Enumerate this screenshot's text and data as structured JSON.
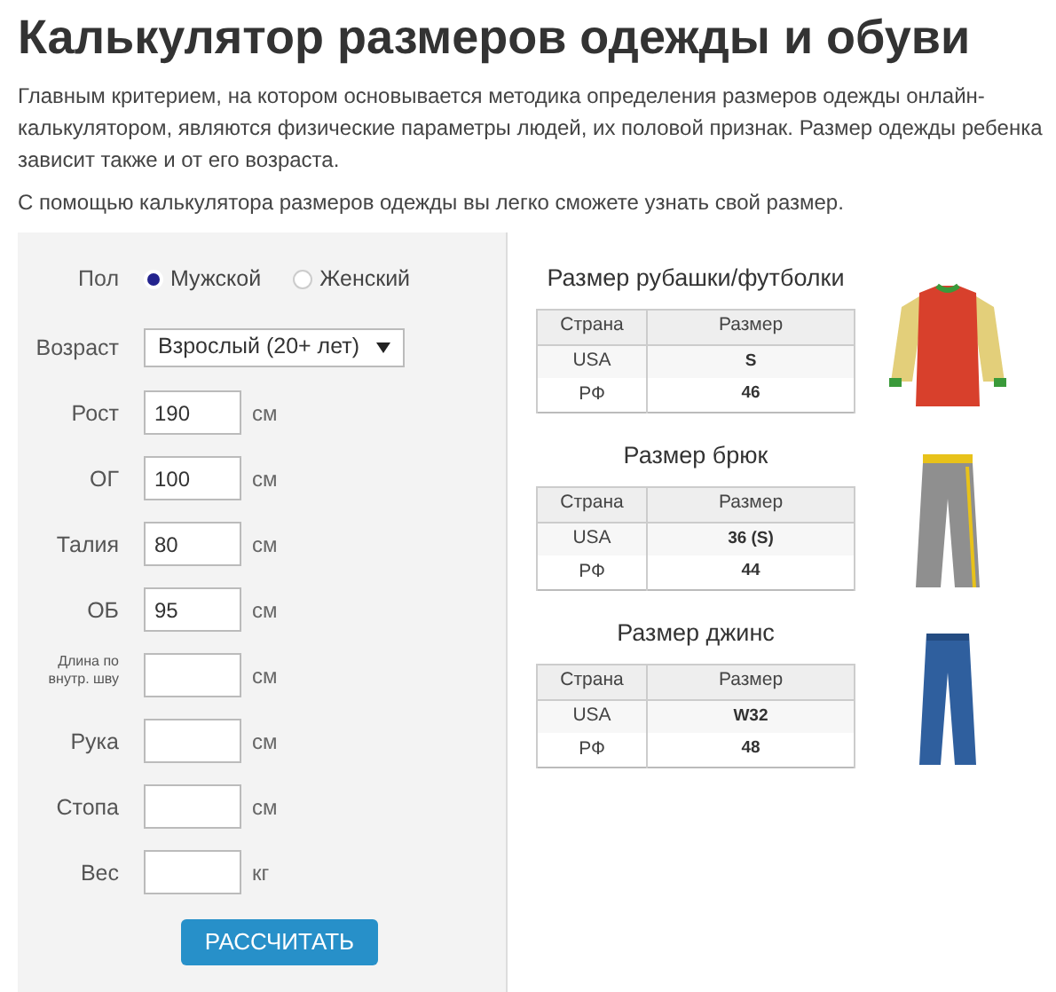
{
  "title": "Калькулятор размеров одежды и обуви",
  "intro": [
    "Главным критерием, на котором основывается методика определения размеров одежды онлайн-калькулятором, являются физические параметры людей, их половой признак. Размер одежды ребенка зависит также и от его возраста.",
    "С помощью калькулятора размеров одежды вы легко сможете узнать свой размер."
  ],
  "form": {
    "fields": [
      {
        "kind": "radio",
        "label": "Пол",
        "options": [
          {
            "label": "Мужской",
            "selected": true
          },
          {
            "label": "Женский",
            "selected": false
          }
        ]
      },
      {
        "kind": "select",
        "label": "Возраст",
        "value": "Взрослый (20+ лет)"
      },
      {
        "kind": "input",
        "label": "Рост",
        "value": "190",
        "unit": "см"
      },
      {
        "kind": "input",
        "label": "ОГ",
        "value": "100",
        "unit": "см"
      },
      {
        "kind": "input",
        "label": "Талия",
        "value": "80",
        "unit": "см"
      },
      {
        "kind": "input",
        "label": "ОБ",
        "value": "95",
        "unit": "см"
      },
      {
        "kind": "input",
        "label": "Длина по внутр. шву",
        "small": true,
        "unit": "см"
      },
      {
        "kind": "input",
        "label": "Рука",
        "unit": "см"
      },
      {
        "kind": "input",
        "label": "Стопа",
        "unit": "см"
      },
      {
        "kind": "input",
        "label": "Вес",
        "unit": "кг"
      }
    ],
    "button": "РАССЧИТАТЬ"
  },
  "results": [
    {
      "title": "Размер рубашки/футболки",
      "kind": "shirt",
      "columns": [
        "Страна",
        "Размер"
      ],
      "rows": [
        [
          "USA",
          "S"
        ],
        [
          "РФ",
          "46"
        ]
      ]
    },
    {
      "title": "Размер брюк",
      "kind": "pants",
      "columns": [
        "Страна",
        "Размер"
      ],
      "rows": [
        [
          "USA",
          "36 (S)"
        ],
        [
          "РФ",
          "44"
        ]
      ]
    },
    {
      "title": "Размер джинс",
      "kind": "jeans",
      "columns": [
        "Страна",
        "Размер"
      ],
      "rows": [
        [
          "USA",
          "W32"
        ],
        [
          "РФ",
          "48"
        ]
      ]
    }
  ]
}
